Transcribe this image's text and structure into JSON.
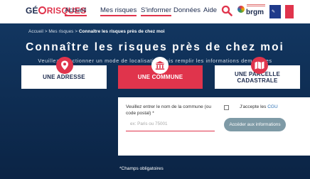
{
  "header": {
    "logo": {
      "part1": "GÉ",
      "part2": "RISQUES"
    },
    "nav": [
      {
        "label": "Accueil",
        "active": true
      },
      {
        "label": "Mes risques",
        "active": true
      },
      {
        "label": "S'informer",
        "active": true
      },
      {
        "label": "Données",
        "active": false
      },
      {
        "label": "Aide",
        "active": false
      }
    ],
    "partner_logo": "brgm",
    "icons": {
      "search": "search-icon",
      "partner": "brgm-logo",
      "state": "republique-francaise-logo"
    }
  },
  "breadcrumb": {
    "home": "Accueil",
    "sep": ">",
    "section": "Mes risques",
    "current": "Connaître les risques près de chez moi"
  },
  "page": {
    "title": "Connaître les risques près de chez moi",
    "subtitle": "Veuillez sélectionner un mode de localisation puis remplir les informations demandées"
  },
  "options": [
    {
      "label": "UNE ADRESSE",
      "icon": "location-pin-icon",
      "selected": false
    },
    {
      "label": "UNE COMMUNE",
      "icon": "town-hall-icon",
      "selected": true
    },
    {
      "label": "UNE PARCELLE CADASTRALE",
      "icon": "map-icon",
      "selected": false
    }
  ],
  "form": {
    "label": "Veuillez entrer le nom de la commune (ou code postal) *",
    "input_value": "",
    "input_placeholder": "ex: Paris ou 75001",
    "cgu_prefix": "J'accepte les",
    "cgu_link": "CGU",
    "cgu_checked": false,
    "submit": "Accéder aux informations"
  },
  "required_note": "*Champs obligatoires",
  "colors": {
    "navy": "#0d2a4c",
    "accent": "#e0344c",
    "submit": "#7e9aa6"
  }
}
